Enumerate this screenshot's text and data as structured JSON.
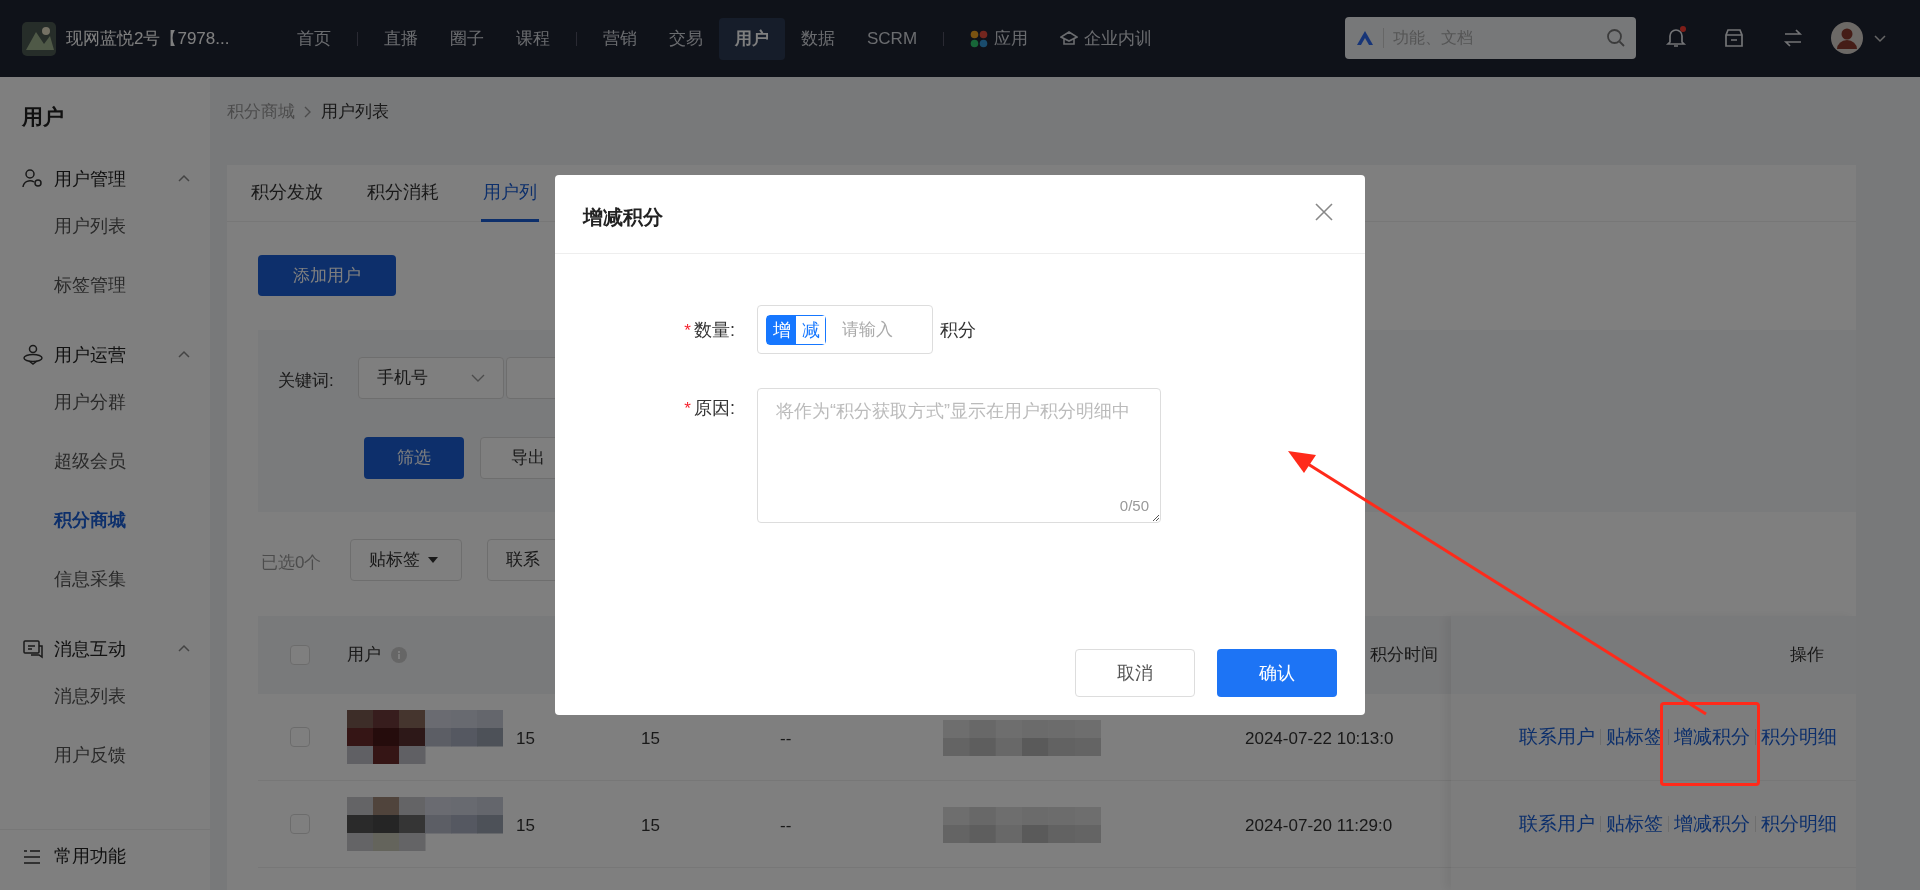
{
  "top_bar": {
    "org_name": "现网蓝悦2号【7978...",
    "nav_groups": [
      [
        {
          "label": "首页",
          "kind": "text",
          "selected": false
        }
      ],
      [
        {
          "label": "直播",
          "kind": "text",
          "selected": false
        },
        {
          "label": "圈子",
          "kind": "text",
          "selected": false
        },
        {
          "label": "课程",
          "kind": "text",
          "selected": false
        }
      ],
      [
        {
          "label": "营销",
          "kind": "text",
          "selected": false
        },
        {
          "label": "交易",
          "kind": "text",
          "selected": false
        },
        {
          "label": "用户",
          "kind": "text",
          "selected": true
        },
        {
          "label": "数据",
          "kind": "text",
          "selected": false
        },
        {
          "label": "SCRM",
          "kind": "text",
          "selected": false
        }
      ],
      [
        {
          "label": "应用",
          "kind": "apps",
          "selected": false
        },
        {
          "label": "企业内训",
          "kind": "training",
          "selected": false
        }
      ]
    ],
    "search": {
      "placeholder": "功能、文档"
    },
    "has_unread": true
  },
  "sidebar": {
    "title": "用户",
    "groups": [
      {
        "label": "用户管理",
        "kind": "user-admin",
        "expanded": true,
        "children": [
          {
            "label": "用户列表",
            "selected": false
          },
          {
            "label": "标签管理",
            "selected": false
          }
        ]
      },
      {
        "label": "用户运营",
        "kind": "operation",
        "expanded": true,
        "children": [
          {
            "label": "用户分群",
            "selected": false
          },
          {
            "label": "超级会员",
            "selected": false
          },
          {
            "label": "积分商城",
            "selected": true
          },
          {
            "label": "信息采集",
            "selected": false
          }
        ]
      },
      {
        "label": "消息互动",
        "kind": "message",
        "expanded": true,
        "children": [
          {
            "label": "消息列表",
            "selected": false
          },
          {
            "label": "用户反馈",
            "selected": false
          }
        ]
      }
    ],
    "footer": "常用功能"
  },
  "breadcrumb": [
    "积分商城",
    "用户列表"
  ],
  "tabs": [
    {
      "label": "积分发放",
      "selected": false
    },
    {
      "label": "积分消耗",
      "selected": false
    },
    {
      "label": "用户列",
      "selected": true
    }
  ],
  "add_button": "添加用户",
  "filter": {
    "label": "关键词:",
    "select": "手机号",
    "buttons": [
      {
        "label": "筛选",
        "kind": "primary"
      },
      {
        "label": "导出",
        "kind": "plain"
      }
    ]
  },
  "bulk": {
    "selected_count": "已选0个",
    "buttons": [
      {
        "label": "贴标签",
        "kind": "dropdown"
      },
      {
        "label": "联系",
        "kind": "plain"
      }
    ]
  },
  "table": {
    "header_checked": false,
    "columns": {
      "user": "用户",
      "time": "积分时间",
      "actions": "操作"
    },
    "rows": [
      {
        "checked": false,
        "column_3": "15",
        "column_4": "15",
        "column_5": "--",
        "time": "2024-07-22 10:13:0",
        "actions": [
          "联系用户",
          "贴标签",
          "增减积分",
          "积分明细"
        ]
      },
      {
        "checked": false,
        "column_3": "15",
        "column_4": "15",
        "column_5": "--",
        "time": "2024-07-20 11:29:0",
        "actions": [
          "联系用户",
          "贴标签",
          "增减积分",
          "积分明细"
        ]
      }
    ]
  },
  "dialog": {
    "title": "增减积分",
    "quantity": {
      "asterisk": "*",
      "label": "数量:",
      "toggles": [
        {
          "label": "增",
          "selected": true
        },
        {
          "label": "减",
          "selected": false
        }
      ],
      "placeholder": "请输入",
      "unit": "积分"
    },
    "reason": {
      "asterisk": "*",
      "label": "原因:",
      "placeholder": "将作为“积分获取方式”显示在用户积分明细中",
      "counter": "0/50"
    },
    "cancel": "取消",
    "confirm": "确认"
  }
}
